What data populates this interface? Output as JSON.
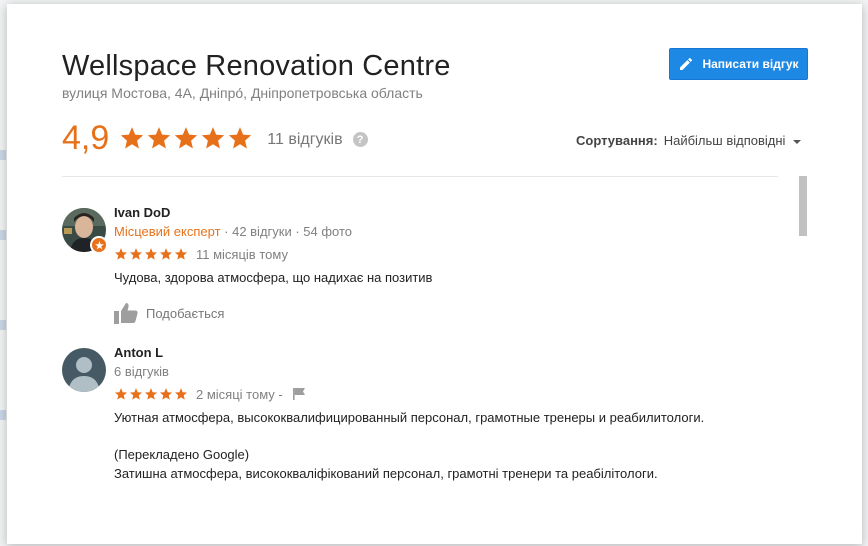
{
  "place": {
    "name": "Wellspace Renovation Centre",
    "address": "вулиця Мостова, 4А, Дніпро́, Дніпропетровська область"
  },
  "actions": {
    "write_review_label": "Написати відгук",
    "write_review_icon": "pencil-icon"
  },
  "rating": {
    "value": "4,9",
    "stars": 5,
    "count_label": "11 відгуків",
    "help_label": "?"
  },
  "sort": {
    "label": "Сортування:",
    "value": "Найбільш відповідні"
  },
  "colors": {
    "accent_orange": "#e7711b",
    "button_blue": "#1e88e5"
  },
  "reviews": [
    {
      "name": "Ivan DoD",
      "badge": "Місцевий експерт",
      "meta": " · 42 відгуки · 54 фото",
      "stars": 5,
      "time": "11 місяців тому",
      "text": "Чудова, здорова атмосфера, що надихає на позитив",
      "like_label": "Подобається"
    },
    {
      "name": "Anton L",
      "meta": "6 відгуків",
      "stars": 5,
      "time": "2 місяці тому",
      "time_sep": "-",
      "text": "Уютная атмосфера, высококвалифицированный персонал, грамотные тренеры и реабилитологи.",
      "translated_note": "(Перекладено Google)",
      "translated_text": "Затишна атмосфера, висококваліфікований персонал, грамотні тренери та реабілітологи."
    }
  ]
}
